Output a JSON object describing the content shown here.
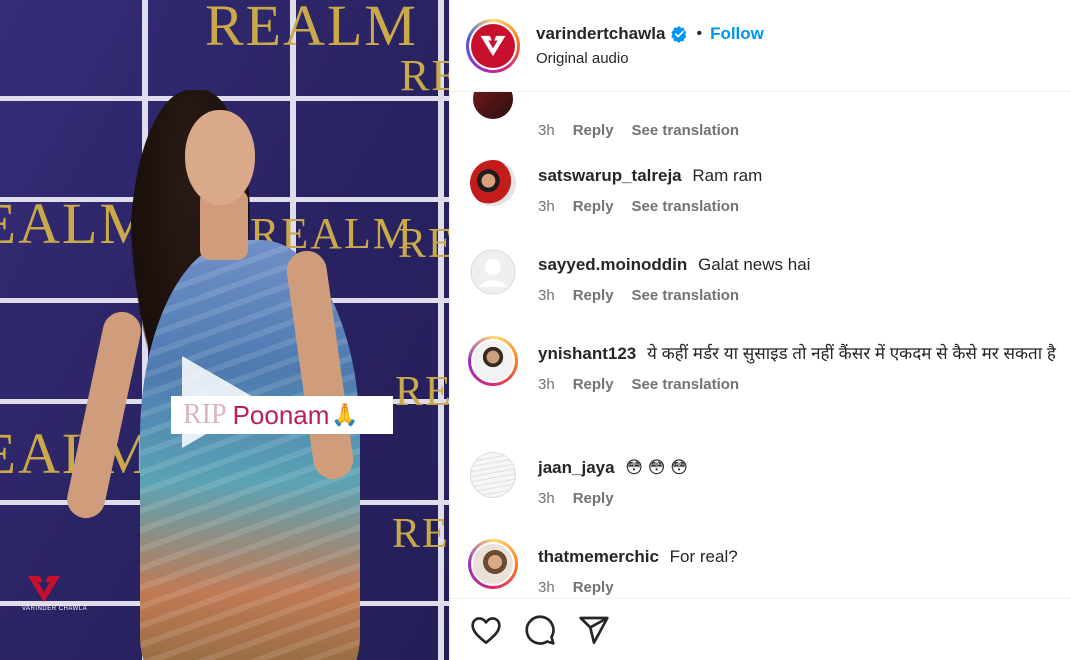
{
  "video": {
    "wall_words": [
      "REALM",
      "REALM",
      "REALM",
      "REALM",
      "REALM",
      "REALM",
      "REALM",
      "REALM"
    ],
    "overlay": {
      "rip": "RIP",
      "name": "Poonam",
      "emoji": "🙏"
    },
    "brand_tag": "VARINDER CHAWLA"
  },
  "header": {
    "username": "varindertchawla",
    "separator": "•",
    "follow_label": "Follow",
    "audio_label": "Original audio"
  },
  "comments": [
    {
      "username": "",
      "text": "",
      "time": "3h",
      "reply_label": "Reply",
      "translation_label": "See translation",
      "avatar_icon": "partial-avatar"
    },
    {
      "username": "satswarup_talreja",
      "text": "Ram ram",
      "time": "3h",
      "reply_label": "Reply",
      "translation_label": "See translation",
      "avatar_icon": "user-photo-icon"
    },
    {
      "username": "sayyed.moinoddin",
      "text": "Galat news hai",
      "time": "3h",
      "reply_label": "Reply",
      "translation_label": "See translation",
      "avatar_icon": "default-avatar-icon"
    },
    {
      "username": "ynishant123",
      "text": "ये कहीं मर्डर या सुसाइड तो नहीं कैंसर में एकदम से कैसे मर सकता है",
      "time": "3h",
      "reply_label": "Reply",
      "translation_label": "See translation",
      "avatar_icon": "user-photo-icon"
    },
    {
      "username": "jaan_jaya",
      "text": "😳 😳 😳",
      "time": "3h",
      "reply_label": "Reply",
      "avatar_icon": "user-photo-icon"
    },
    {
      "username": "thatmemerchic",
      "text": "For real?",
      "time": "3h",
      "reply_label": "Reply",
      "avatar_icon": "user-photo-icon"
    }
  ],
  "colors": {
    "follow": "#0095f6",
    "verified": "#0095f6",
    "brand_red": "#c8102e",
    "meta_gray": "#737373"
  }
}
